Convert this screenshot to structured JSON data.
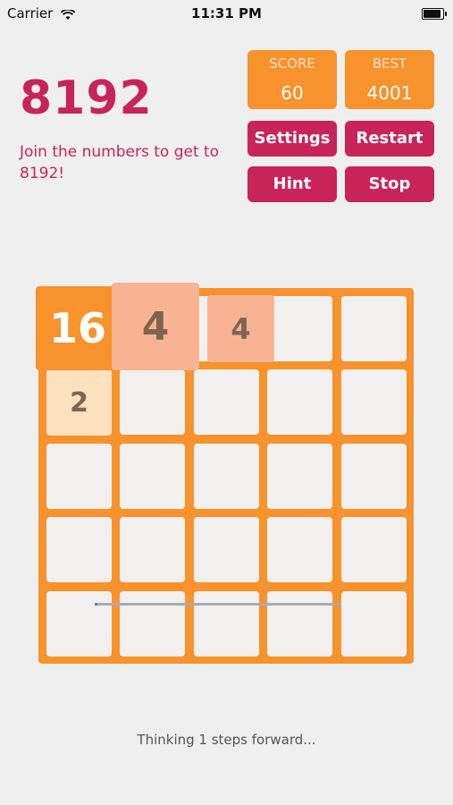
{
  "status_bar": {
    "carrier": "Carrier",
    "time": "11:31 PM",
    "wifi_icon": "wifi-icon",
    "battery_icon": "battery-icon",
    "battery_level": 0.9
  },
  "header": {
    "title": "8192",
    "subtitle": "Join the numbers to get to 8192!"
  },
  "score": {
    "label": "SCORE",
    "value": "60"
  },
  "best": {
    "label": "BEST",
    "value": "4001"
  },
  "buttons": {
    "settings": "Settings",
    "restart": "Restart",
    "hint": "Hint",
    "stop": "Stop"
  },
  "colors": {
    "accent": "#c8245a",
    "board": "#f7922c",
    "cell": "#f1f0ef",
    "background": "#efeff0"
  },
  "board": {
    "size": 5,
    "tiles": [
      {
        "value": "16",
        "row": 0,
        "col": 0,
        "color": "#f7922c"
      },
      {
        "value": "4",
        "row": 0,
        "col": 1,
        "color": "#f8b394"
      },
      {
        "value": "4",
        "row": 0,
        "col": 2,
        "color": "#f8b394"
      },
      {
        "value": "2",
        "row": 1,
        "col": 0,
        "color": "#fbe1bd"
      }
    ]
  },
  "progress": {
    "fraction": 0.01
  },
  "footer": {
    "thinking": "Thinking 1 steps forward..."
  }
}
